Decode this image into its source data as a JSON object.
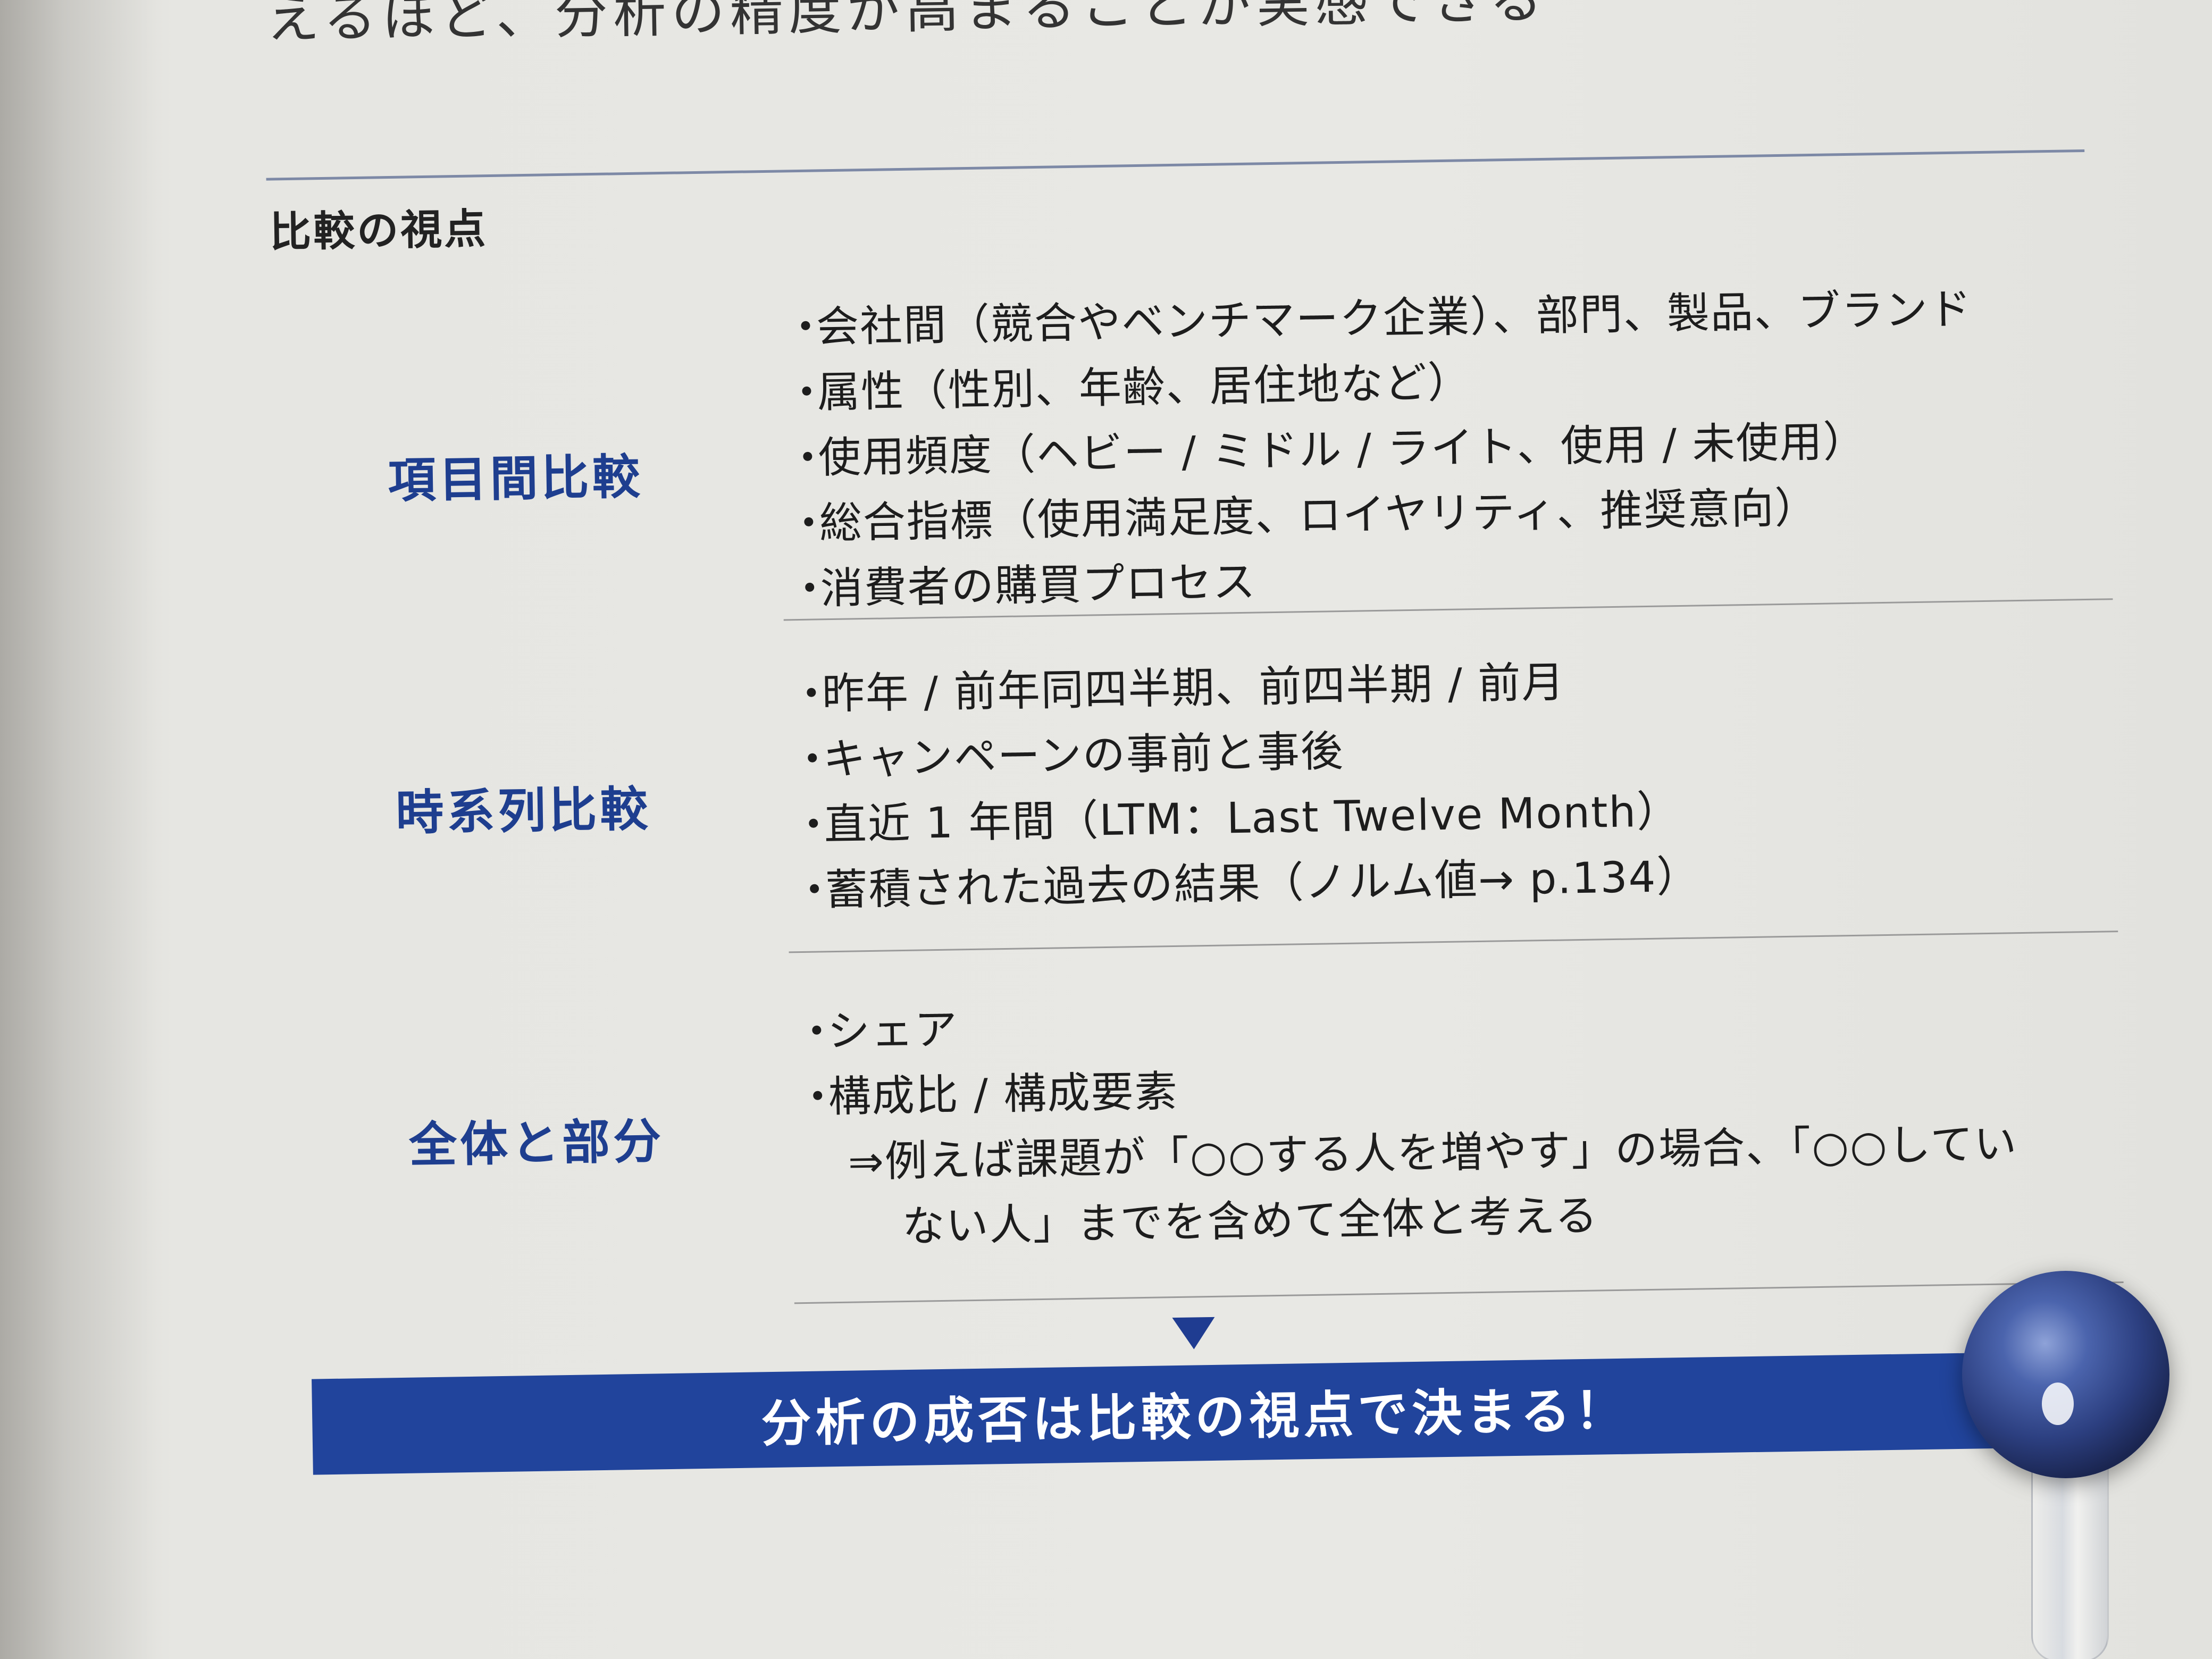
{
  "top_text": "えるほど、分析の精度が高まることが実感できる",
  "section_title": "比較の視点",
  "rows": [
    {
      "label": "項目間比較",
      "items": [
        "会社間（競合やベンチマーク企業）、部門、製品、ブランド",
        "属性（性別、年齢、居住地など）",
        "使用頻度（ヘビー / ミドル / ライト、使用 / 未使用）",
        "総合指標（使用満足度、ロイヤリティ、推奨意向）",
        "消費者の購買プロセス"
      ]
    },
    {
      "label": "時系列比較",
      "items": [
        "昨年 / 前年同四半期、前四半期 / 前月",
        "キャンペーンの事前と事後",
        "直近 1 年間（LTM：Last Twelve Month）",
        "蓄積された過去の結果（ノルム値→ p.134）"
      ]
    },
    {
      "label": "全体と部分",
      "items": [
        "シェア",
        "構成比 / 構成要素"
      ],
      "note_lines": [
        "⇒例えば課題が「○○する人を増やす」の場合、「○○してい",
        "ない人」までを含めて全体と考える"
      ]
    }
  ],
  "bullet": "・",
  "banner_text": "分析の成否は比較の視点で決まる！",
  "colors": {
    "accent_blue": "#1e3e8f",
    "banner_blue": "#21449c",
    "paper": "#e8e8e4",
    "text": "#1d1d1d"
  }
}
